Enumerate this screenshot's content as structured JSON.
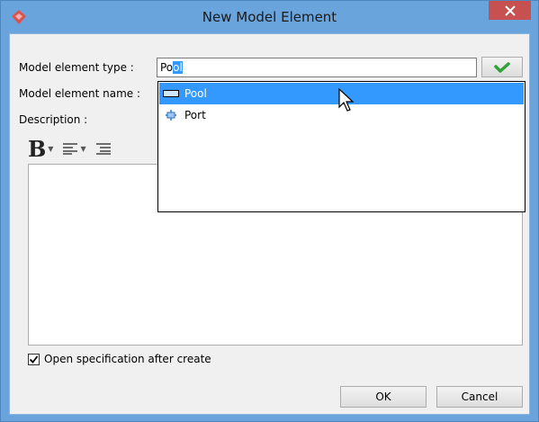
{
  "window": {
    "title": "New Model Element",
    "close_label": "×"
  },
  "form": {
    "type_label": "Model element type :",
    "type_value_typed": "Po",
    "type_value_selected": "ol",
    "name_label": "Model element name :",
    "description_label": "Description :"
  },
  "dropdown": {
    "items": [
      {
        "label": "Pool",
        "icon": "pool-icon",
        "selected": true
      },
      {
        "label": "Port",
        "icon": "port-icon",
        "selected": false
      }
    ]
  },
  "toolbar": {
    "bold_glyph": "B",
    "icons": [
      "bold-icon",
      "align-icon",
      "list-icon"
    ]
  },
  "options": {
    "open_spec_label": "Open specification after create",
    "open_spec_checked": true
  },
  "buttons": {
    "ok_label": "OK",
    "cancel_label": "Cancel"
  },
  "colors": {
    "title_bar": "#6aa4dc",
    "close_button": "#c75050",
    "selection": "#3399ff",
    "confirm_check": "#2fa33a"
  }
}
